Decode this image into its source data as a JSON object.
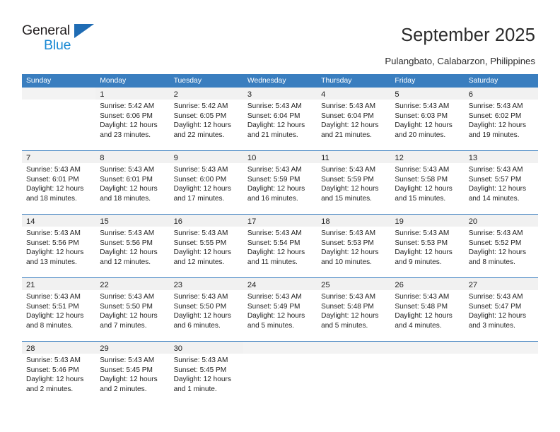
{
  "brand": {
    "name_top": "General",
    "name_bottom": "Blue",
    "accent_blue": "#1b8ad4",
    "triangle_blue": "#1f6cb4",
    "text_dark": "#231f20"
  },
  "header": {
    "title": "September 2025",
    "subtitle": "Pulangbato, Calabarzon, Philippines"
  },
  "calendar": {
    "header_bg": "#3a7ebf",
    "daynum_band_bg": "#f1f1f1",
    "weekday_headers": [
      "Sunday",
      "Monday",
      "Tuesday",
      "Wednesday",
      "Thursday",
      "Friday",
      "Saturday"
    ],
    "weeks": [
      [
        {
          "day": "",
          "lines": []
        },
        {
          "day": "1",
          "lines": [
            "Sunrise: 5:42 AM",
            "Sunset: 6:06 PM",
            "Daylight: 12 hours",
            "and 23 minutes."
          ]
        },
        {
          "day": "2",
          "lines": [
            "Sunrise: 5:42 AM",
            "Sunset: 6:05 PM",
            "Daylight: 12 hours",
            "and 22 minutes."
          ]
        },
        {
          "day": "3",
          "lines": [
            "Sunrise: 5:43 AM",
            "Sunset: 6:04 PM",
            "Daylight: 12 hours",
            "and 21 minutes."
          ]
        },
        {
          "day": "4",
          "lines": [
            "Sunrise: 5:43 AM",
            "Sunset: 6:04 PM",
            "Daylight: 12 hours",
            "and 21 minutes."
          ]
        },
        {
          "day": "5",
          "lines": [
            "Sunrise: 5:43 AM",
            "Sunset: 6:03 PM",
            "Daylight: 12 hours",
            "and 20 minutes."
          ]
        },
        {
          "day": "6",
          "lines": [
            "Sunrise: 5:43 AM",
            "Sunset: 6:02 PM",
            "Daylight: 12 hours",
            "and 19 minutes."
          ]
        }
      ],
      [
        {
          "day": "7",
          "lines": [
            "Sunrise: 5:43 AM",
            "Sunset: 6:01 PM",
            "Daylight: 12 hours",
            "and 18 minutes."
          ]
        },
        {
          "day": "8",
          "lines": [
            "Sunrise: 5:43 AM",
            "Sunset: 6:01 PM",
            "Daylight: 12 hours",
            "and 18 minutes."
          ]
        },
        {
          "day": "9",
          "lines": [
            "Sunrise: 5:43 AM",
            "Sunset: 6:00 PM",
            "Daylight: 12 hours",
            "and 17 minutes."
          ]
        },
        {
          "day": "10",
          "lines": [
            "Sunrise: 5:43 AM",
            "Sunset: 5:59 PM",
            "Daylight: 12 hours",
            "and 16 minutes."
          ]
        },
        {
          "day": "11",
          "lines": [
            "Sunrise: 5:43 AM",
            "Sunset: 5:59 PM",
            "Daylight: 12 hours",
            "and 15 minutes."
          ]
        },
        {
          "day": "12",
          "lines": [
            "Sunrise: 5:43 AM",
            "Sunset: 5:58 PM",
            "Daylight: 12 hours",
            "and 15 minutes."
          ]
        },
        {
          "day": "13",
          "lines": [
            "Sunrise: 5:43 AM",
            "Sunset: 5:57 PM",
            "Daylight: 12 hours",
            "and 14 minutes."
          ]
        }
      ],
      [
        {
          "day": "14",
          "lines": [
            "Sunrise: 5:43 AM",
            "Sunset: 5:56 PM",
            "Daylight: 12 hours",
            "and 13 minutes."
          ]
        },
        {
          "day": "15",
          "lines": [
            "Sunrise: 5:43 AM",
            "Sunset: 5:56 PM",
            "Daylight: 12 hours",
            "and 12 minutes."
          ]
        },
        {
          "day": "16",
          "lines": [
            "Sunrise: 5:43 AM",
            "Sunset: 5:55 PM",
            "Daylight: 12 hours",
            "and 12 minutes."
          ]
        },
        {
          "day": "17",
          "lines": [
            "Sunrise: 5:43 AM",
            "Sunset: 5:54 PM",
            "Daylight: 12 hours",
            "and 11 minutes."
          ]
        },
        {
          "day": "18",
          "lines": [
            "Sunrise: 5:43 AM",
            "Sunset: 5:53 PM",
            "Daylight: 12 hours",
            "and 10 minutes."
          ]
        },
        {
          "day": "19",
          "lines": [
            "Sunrise: 5:43 AM",
            "Sunset: 5:53 PM",
            "Daylight: 12 hours",
            "and 9 minutes."
          ]
        },
        {
          "day": "20",
          "lines": [
            "Sunrise: 5:43 AM",
            "Sunset: 5:52 PM",
            "Daylight: 12 hours",
            "and 8 minutes."
          ]
        }
      ],
      [
        {
          "day": "21",
          "lines": [
            "Sunrise: 5:43 AM",
            "Sunset: 5:51 PM",
            "Daylight: 12 hours",
            "and 8 minutes."
          ]
        },
        {
          "day": "22",
          "lines": [
            "Sunrise: 5:43 AM",
            "Sunset: 5:50 PM",
            "Daylight: 12 hours",
            "and 7 minutes."
          ]
        },
        {
          "day": "23",
          "lines": [
            "Sunrise: 5:43 AM",
            "Sunset: 5:50 PM",
            "Daylight: 12 hours",
            "and 6 minutes."
          ]
        },
        {
          "day": "24",
          "lines": [
            "Sunrise: 5:43 AM",
            "Sunset: 5:49 PM",
            "Daylight: 12 hours",
            "and 5 minutes."
          ]
        },
        {
          "day": "25",
          "lines": [
            "Sunrise: 5:43 AM",
            "Sunset: 5:48 PM",
            "Daylight: 12 hours",
            "and 5 minutes."
          ]
        },
        {
          "day": "26",
          "lines": [
            "Sunrise: 5:43 AM",
            "Sunset: 5:48 PM",
            "Daylight: 12 hours",
            "and 4 minutes."
          ]
        },
        {
          "day": "27",
          "lines": [
            "Sunrise: 5:43 AM",
            "Sunset: 5:47 PM",
            "Daylight: 12 hours",
            "and 3 minutes."
          ]
        }
      ],
      [
        {
          "day": "28",
          "lines": [
            "Sunrise: 5:43 AM",
            "Sunset: 5:46 PM",
            "Daylight: 12 hours",
            "and 2 minutes."
          ]
        },
        {
          "day": "29",
          "lines": [
            "Sunrise: 5:43 AM",
            "Sunset: 5:45 PM",
            "Daylight: 12 hours",
            "and 2 minutes."
          ]
        },
        {
          "day": "30",
          "lines": [
            "Sunrise: 5:43 AM",
            "Sunset: 5:45 PM",
            "Daylight: 12 hours",
            "and 1 minute."
          ]
        },
        {
          "day": "",
          "lines": []
        },
        {
          "day": "",
          "lines": []
        },
        {
          "day": "",
          "lines": []
        },
        {
          "day": "",
          "lines": []
        }
      ]
    ]
  }
}
